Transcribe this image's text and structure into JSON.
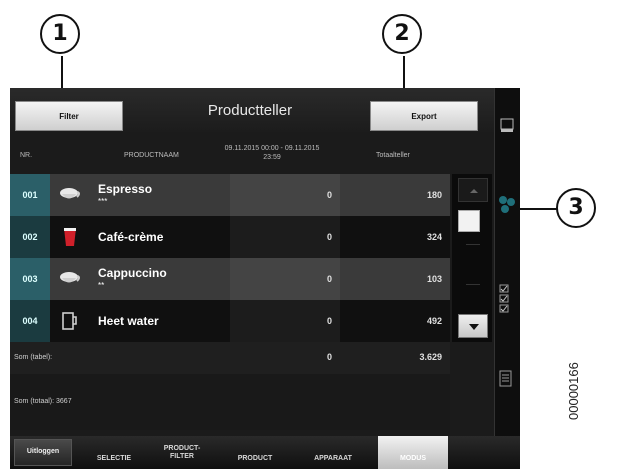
{
  "callouts": [
    "1",
    "2",
    "3"
  ],
  "screen": {
    "title": "Productteller",
    "filter_label": "Filter",
    "export_label": "Export",
    "columns": {
      "nr": "NR.",
      "name": "PRODUCTNAAM",
      "period": "09.11.2015 00:00 - 09.11.2015 23:59",
      "total": "Totaalteller"
    },
    "rows": [
      {
        "nr": "001",
        "name": "Espresso",
        "strength": "***",
        "period": "0",
        "total": "180",
        "icon": "cup-icon"
      },
      {
        "nr": "002",
        "name": "Café-crème",
        "strength": "",
        "period": "0",
        "total": "324",
        "icon": "red-cup-icon"
      },
      {
        "nr": "003",
        "name": "Cappuccino",
        "strength": "**",
        "period": "0",
        "total": "103",
        "icon": "cup-icon"
      },
      {
        "nr": "004",
        "name": "Heet water",
        "strength": "",
        "period": "0",
        "total": "492",
        "icon": "mug-icon"
      }
    ],
    "sum_table_label": "Som (tabel):",
    "sum_table_period": "0",
    "sum_table_total": "3.629",
    "sum_total_label": "Som (totaal): 3667"
  },
  "nav": {
    "logout": "Uitloggen",
    "selectie": "SELECTIE",
    "filter_line1": "PRODUCT-",
    "filter_line2": "FILTER",
    "product": "PRODUCT",
    "apparaat": "APPARAAT",
    "modus": "MODUS"
  },
  "figure_id": "00000166"
}
